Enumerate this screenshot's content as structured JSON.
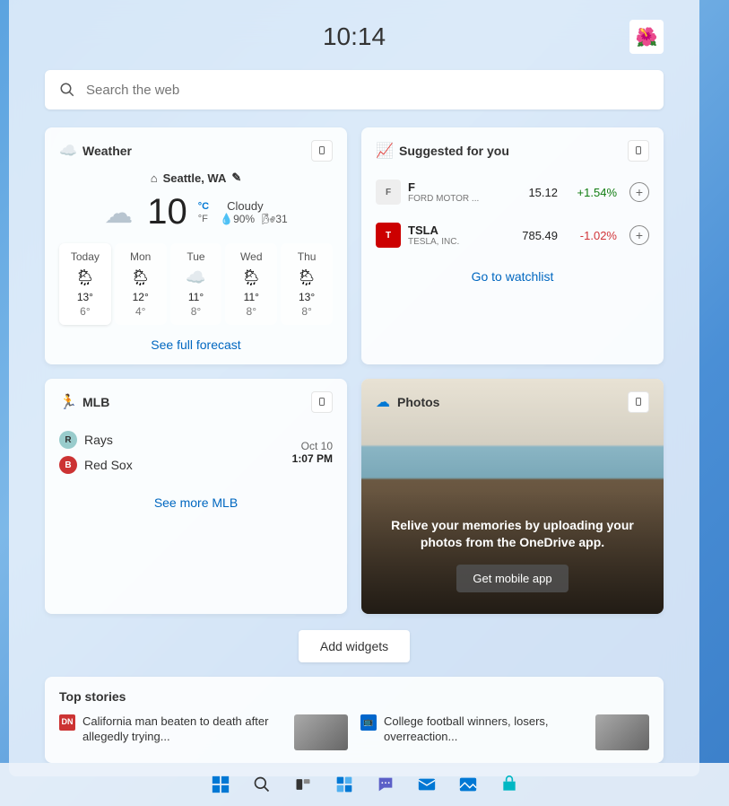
{
  "clock": "10:14",
  "avatar_emoji": "🌺",
  "search": {
    "placeholder": "Search the web"
  },
  "weather": {
    "title": "Weather",
    "location": "Seattle, WA",
    "temp": "10",
    "unit_c": "°C",
    "unit_f": "°F",
    "condition": "Cloudy",
    "humidity": "90%",
    "wind": "31",
    "forecast": [
      {
        "day": "Today",
        "hi": "13°",
        "lo": "6°"
      },
      {
        "day": "Mon",
        "hi": "12°",
        "lo": "4°"
      },
      {
        "day": "Tue",
        "hi": "11°",
        "lo": "8°"
      },
      {
        "day": "Wed",
        "hi": "11°",
        "lo": "8°"
      },
      {
        "day": "Thu",
        "hi": "13°",
        "lo": "8°"
      }
    ],
    "link": "See full forecast"
  },
  "stocks": {
    "title": "Suggested for you",
    "items": [
      {
        "symbol": "F",
        "company": "FORD MOTOR ...",
        "price": "15.12",
        "change": "+1.54%",
        "dir": "up"
      },
      {
        "symbol": "TSLA",
        "company": "TESLA, INC.",
        "price": "785.49",
        "change": "-1.02%",
        "dir": "dn"
      }
    ],
    "link": "Go to watchlist"
  },
  "mlb": {
    "title": "MLB",
    "team1": "Rays",
    "team2": "Red Sox",
    "date": "Oct 10",
    "time": "1:07 PM",
    "link": "See more MLB"
  },
  "photos": {
    "title": "Photos",
    "message": "Relive your memories by uploading your photos from the OneDrive app.",
    "button": "Get mobile app"
  },
  "add_widgets": "Add widgets",
  "stories": {
    "title": "Top stories",
    "items": [
      {
        "src": "DN",
        "headline": "California man beaten to death after allegedly trying..."
      },
      {
        "src": "📺",
        "headline": "College football winners, losers, overreaction..."
      }
    ]
  }
}
